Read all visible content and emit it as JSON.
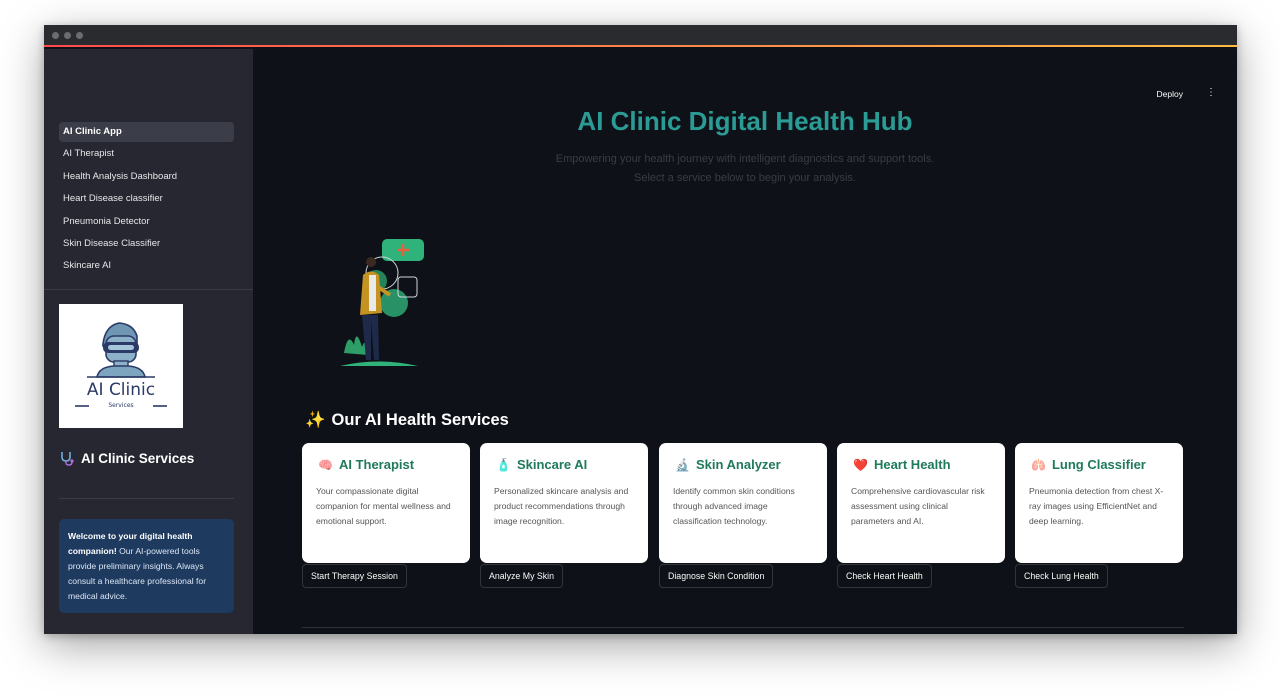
{
  "sidebar": {
    "nav": [
      {
        "label": "AI Clinic App",
        "active": true
      },
      {
        "label": "AI Therapist"
      },
      {
        "label": "Health Analysis Dashboard"
      },
      {
        "label": "Heart Disease classifier"
      },
      {
        "label": "Pneumonia Detector"
      },
      {
        "label": "Skin Disease Classifier"
      },
      {
        "label": "Skincare AI"
      }
    ],
    "logo": {
      "title": "AI Clinic",
      "subtitle": "Services"
    },
    "title": "AI Clinic Services",
    "title_icon": "stethoscope-icon",
    "info": {
      "bold": "Welcome to your digital health companion!",
      "text": " Our AI-powered tools provide preliminary insights. Always consult a healthcare professional for medical advice."
    }
  },
  "header": {
    "deploy_label": "Deploy",
    "menu_icon": "more-vert-icon"
  },
  "hero": {
    "title": "AI Clinic Digital Health Hub",
    "subtitle_line1": "Empowering your health journey with intelligent diagnostics and support tools.",
    "subtitle_line2": "Select a service below to begin your analysis."
  },
  "services": {
    "title": "Our AI Health Services",
    "title_icon": "sparkles-icon",
    "cards": [
      {
        "icon": "🧠",
        "title": "AI Therapist",
        "desc": "Your compassionate digital companion for mental wellness and emotional support.",
        "button": "Start Therapy Session"
      },
      {
        "icon": "🧴",
        "title": "Skincare AI",
        "desc": "Personalized skincare analysis and product recommendations through image recognition.",
        "button": "Analyze My Skin"
      },
      {
        "icon": "🔬",
        "title": "Skin Analyzer",
        "desc": "Identify common skin conditions through advanced image classification technology.",
        "button": "Diagnose Skin Condition"
      },
      {
        "icon": "❤️",
        "title": "Heart Health",
        "desc": "Comprehensive cardiovascular risk assessment using clinical parameters and AI.",
        "button": "Check Heart Health"
      },
      {
        "icon": "🫁",
        "title": "Lung Classifier",
        "desc": "Pneumonia detection from chest X-ray images using EfficientNet and deep learning.",
        "button": "Check Lung Health"
      }
    ]
  },
  "colors": {
    "accent": "#2b9c95",
    "card_title": "#1f7a5a",
    "sidebar_bg": "#262730",
    "main_bg": "#0e1117",
    "info_bg": "#1f3a5f"
  }
}
